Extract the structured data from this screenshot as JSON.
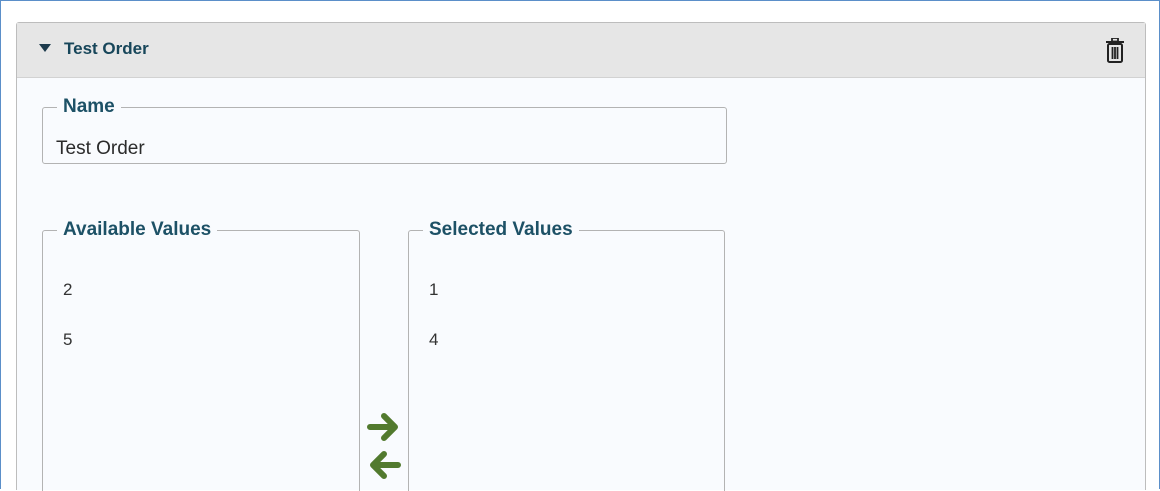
{
  "panel": {
    "title": "Test Order",
    "expanded": true,
    "delete_icon": "trash-icon",
    "caret_icon": "caret-down-icon"
  },
  "name_field": {
    "label": "Name",
    "value": "Test Order"
  },
  "available": {
    "label": "Available Values",
    "items": [
      "2",
      "5"
    ]
  },
  "selected": {
    "label": "Selected Values",
    "items": [
      "1",
      "4"
    ]
  },
  "transfer": {
    "add_icon": "arrow-right-icon",
    "remove_icon": "arrow-left-icon"
  },
  "colors": {
    "accent": "#17465a",
    "arrow": "#527a2e",
    "header_bg": "#e6e6e6",
    "outer_border": "#5b8fc9"
  }
}
